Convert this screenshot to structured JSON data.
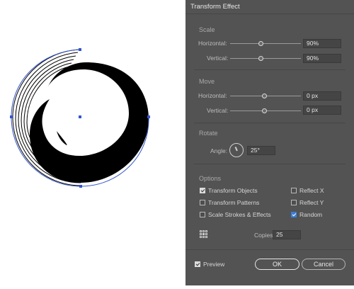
{
  "dialog": {
    "title": "Transform Effect",
    "scale": {
      "title": "Scale",
      "horizontal_label": "Horizontal:",
      "horizontal_value": "90%",
      "vertical_label": "Vertical:",
      "vertical_value": "90%"
    },
    "move": {
      "title": "Move",
      "horizontal_label": "Horizontal:",
      "horizontal_value": "0 px",
      "vertical_label": "Vertical:",
      "vertical_value": "0 px"
    },
    "rotate": {
      "title": "Rotate",
      "angle_label": "Angle:",
      "angle_value": "25°"
    },
    "options": {
      "title": "Options",
      "transform_objects": {
        "label": "Transform Objects",
        "checked": true
      },
      "transform_patterns": {
        "label": "Transform Patterns",
        "checked": false
      },
      "scale_strokes": {
        "label": "Scale Strokes & Effects",
        "checked": false
      },
      "reflect_x": {
        "label": "Reflect X",
        "checked": false
      },
      "reflect_y": {
        "label": "Reflect Y",
        "checked": false
      },
      "random": {
        "label": "Random",
        "checked": true
      }
    },
    "copies_label": "Copies",
    "copies_value": "25",
    "preview": {
      "label": "Preview",
      "checked": true
    },
    "ok_label": "OK",
    "cancel_label": "Cancel"
  },
  "colors": {
    "dialog_bg": "#535353",
    "accent_blue": "#3a7fd6",
    "path_blue": "#3355cc"
  }
}
